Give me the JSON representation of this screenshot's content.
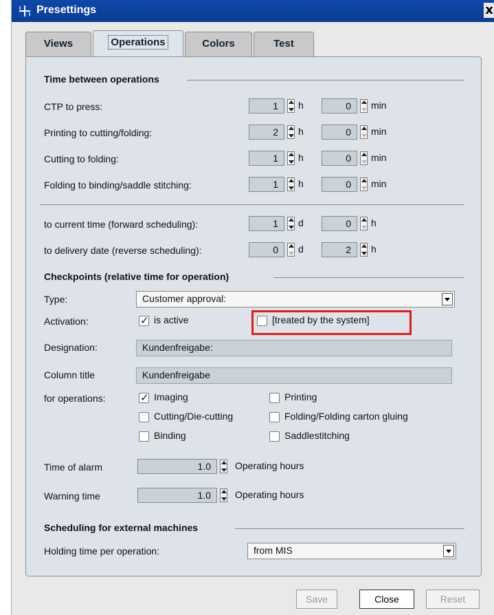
{
  "window": {
    "title": "Presettings",
    "close": "x"
  },
  "tabs": [
    "Views",
    "Operations",
    "Colors",
    "Test"
  ],
  "active_tab": "Operations",
  "time_between": {
    "header": "Time between operations",
    "rows": [
      {
        "label": "CTP to press:",
        "hours": "1",
        "minutes": "0",
        "unit1": "h",
        "unit2": "min"
      },
      {
        "label": "Printing to cutting/folding:",
        "hours": "2",
        "minutes": "0",
        "unit1": "h",
        "unit2": "min"
      },
      {
        "label": "Cutting to folding:",
        "hours": "1",
        "minutes": "0",
        "unit1": "h",
        "unit2": "min"
      },
      {
        "label": "Folding to binding/saddle stitching:",
        "hours": "1",
        "minutes": "0",
        "unit1": "h",
        "unit2": "min"
      }
    ],
    "scheduling": [
      {
        "label": "to current time (forward scheduling):",
        "days": "1",
        "hours": "0",
        "unit1": "d",
        "unit2": "h"
      },
      {
        "label": "to delivery date (reverse scheduling):",
        "days": "0",
        "hours": "2",
        "unit1": "d",
        "unit2": "h"
      }
    ]
  },
  "checkpoints": {
    "header": "Checkpoints (relative time for operation)",
    "type_label": "Type:",
    "type_value": "Customer approval:",
    "activation_label": "Activation:",
    "is_active": "is active",
    "treated": "[treated by the system]",
    "designation_label": "Designation:",
    "designation_value": "Kundenfreigabe:",
    "column_title_label": "Column title",
    "column_title_value": "Kundenfreigabe",
    "operations_label": "for operations:",
    "operations": {
      "imaging": {
        "label": "Imaging",
        "checked": true
      },
      "printing": {
        "label": "Printing",
        "checked": false
      },
      "cutting": {
        "label": "Cutting/Die-cutting",
        "checked": false
      },
      "folding": {
        "label": "Folding/Folding carton gluing",
        "checked": false
      },
      "binding": {
        "label": "Binding",
        "checked": false
      },
      "saddle": {
        "label": "Saddlestitching",
        "checked": false
      }
    },
    "alarm_label": "Time of alarm",
    "alarm_value": "1.0",
    "warning_label": "Warning time",
    "warning_value": "1.0",
    "hours_unit": "Operating hours"
  },
  "external": {
    "header": "Scheduling for external machines",
    "holding_label": "Holding time per operation:",
    "holding_value": "from MIS"
  },
  "buttons": {
    "save": "Save",
    "close": "Close",
    "reset": "Reset"
  },
  "colors": {
    "titlebar": "#0e48a8",
    "highlight": "#e21a1a"
  }
}
